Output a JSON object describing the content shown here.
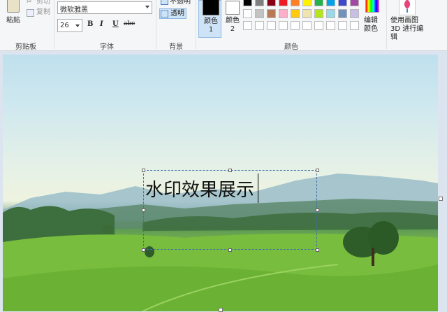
{
  "ribbon": {
    "clipboard": {
      "paste": "粘贴",
      "cut": "剪切",
      "copy": "复制",
      "group": "剪贴板"
    },
    "font": {
      "family": "微软雅黑",
      "size": "26",
      "bold": "B",
      "italic": "I",
      "underline": "U",
      "strike": "abc",
      "group": "字体"
    },
    "background": {
      "opaque": "不透明",
      "transparent": "透明",
      "group": "背景"
    },
    "colors": {
      "color1_label": "颜色 1",
      "color2_label": "颜色 2",
      "edit_colors": "编辑颜色",
      "group": "颜色",
      "palette_row1": [
        "#000000",
        "#7f7f7f",
        "#880015",
        "#ed1c24",
        "#ff7f27",
        "#fff200",
        "#22b14c",
        "#00a2e8",
        "#3f48cc",
        "#a349a4"
      ],
      "palette_row2": [
        "#ffffff",
        "#c3c3c3",
        "#b97a57",
        "#ffaec9",
        "#ffc90e",
        "#efe4b0",
        "#b5e61d",
        "#99d9ea",
        "#7092be",
        "#c8bfe7"
      ],
      "palette_row3": [
        "#ffffff",
        "#ffffff",
        "#ffffff",
        "#ffffff",
        "#ffffff",
        "#ffffff",
        "#ffffff",
        "#ffffff",
        "#ffffff",
        "#ffffff"
      ]
    },
    "paint3d": {
      "label": "使用画图 3D 进行编辑"
    }
  },
  "canvas": {
    "watermark_text": "水印效果展示"
  }
}
